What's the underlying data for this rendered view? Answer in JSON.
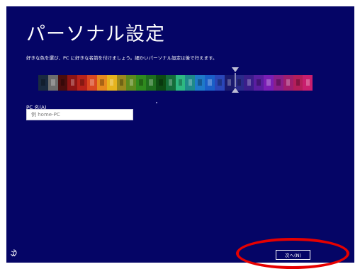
{
  "page": {
    "title": "パーソナル設定",
    "subtitle": "好きな色を選び、PC に好きな名前を付けましょう。細かいパーソナル設定は後で行えます。"
  },
  "colors": {
    "background": "#050566",
    "highlight_annotation": "#e60000",
    "palette": [
      "#1a2a40",
      "#6d6d6d",
      "#4b0d0d",
      "#8c1414",
      "#b8231a",
      "#d94820",
      "#e68a1e",
      "#e6b41e",
      "#9a8a1e",
      "#5c8a1e",
      "#2f8a1e",
      "#1e6e1e",
      "#0d4d14",
      "#146e3a",
      "#2eb882",
      "#1e8a8a",
      "#1e7ac8",
      "#1a5fc8",
      "#2a46b8",
      "#1a1a6e",
      "#2a2a8a",
      "#3a1e8a",
      "#5a1ea0",
      "#7a1eb4",
      "#8a1e8a",
      "#a01e6e",
      "#b41e5a",
      "#c81e6e"
    ]
  },
  "color_picker": {
    "icon": "color-slider-icon",
    "selected_index": 19
  },
  "pc_name": {
    "label": "PC 名(A)",
    "placeholder": "例 home-PC",
    "value": ""
  },
  "footer": {
    "next_label": "次へ(N)",
    "accessibility_icon": "ease-of-access-icon"
  }
}
